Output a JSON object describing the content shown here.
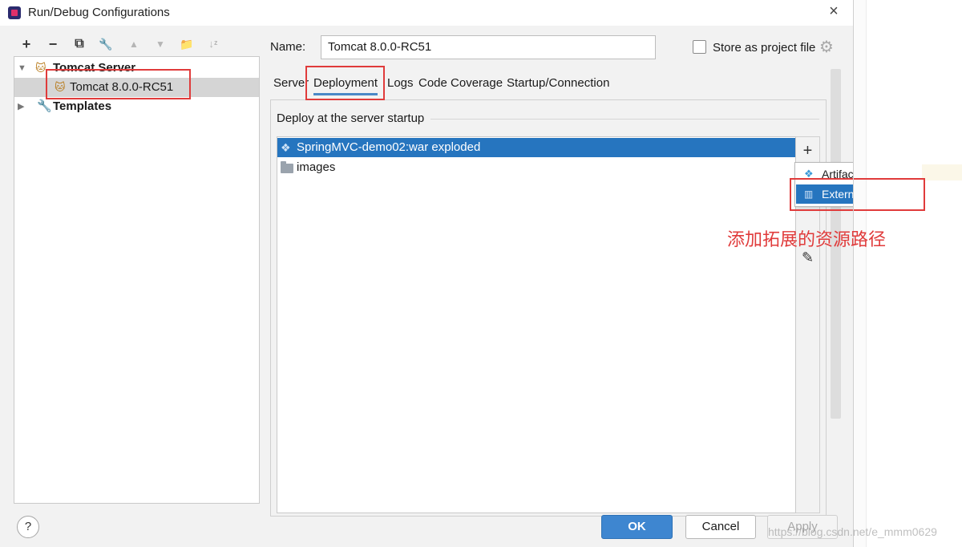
{
  "window": {
    "title": "Run/Debug Configurations",
    "close_icon": "×"
  },
  "toolbar": {
    "add": "+",
    "remove": "−",
    "copy": "⧉",
    "edit": "🔧",
    "move_up": "▲",
    "move_down": "▼",
    "folder": "📁",
    "sort": "↓ᶻ"
  },
  "tree": {
    "group_label": "Tomcat Server",
    "config_label": "Tomcat 8.0.0-RC51",
    "templates_label": "Templates"
  },
  "form": {
    "name_label": "Name:",
    "name_value": "Tomcat 8.0.0-RC51",
    "store_label": "Store as project file"
  },
  "tabs": [
    "Server",
    "Deployment",
    "Logs",
    "Code Coverage",
    "Startup/Connection"
  ],
  "deployment": {
    "section_title": "Deploy at the server startup",
    "items": [
      "SpringMVC-demo02:war exploded",
      "images"
    ]
  },
  "popup": {
    "items": [
      "Artifact...",
      "External Source..."
    ]
  },
  "annotation": "添加拓展的资源路径",
  "buttons": {
    "help": "?",
    "ok": "OK",
    "cancel": "Cancel",
    "apply": "Apply"
  },
  "watermark": "https://blog.csdn.net/e_mmm0629",
  "colors": {
    "selection": "#2675bf",
    "accent": "#3e86d0",
    "annotation": "#e03b3b"
  }
}
